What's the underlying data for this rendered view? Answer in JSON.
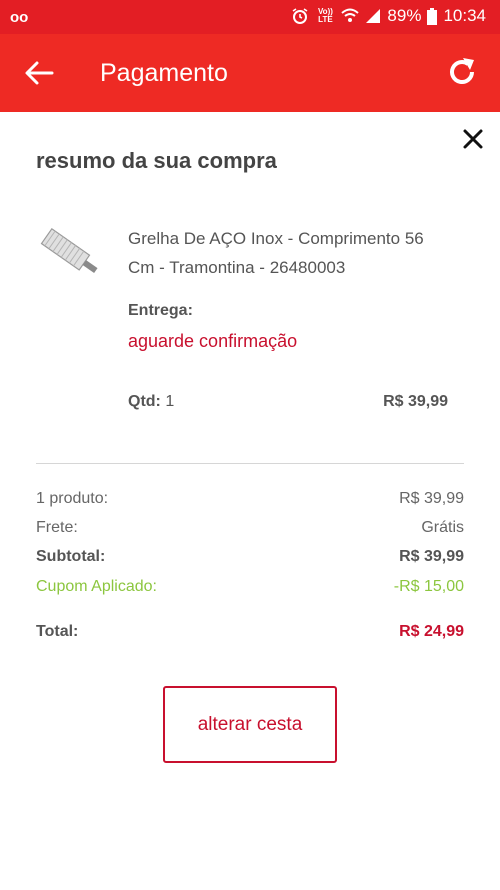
{
  "status_bar": {
    "left_icon": "voicemail-icon",
    "lte": "Vo)) LTE",
    "battery": "89%",
    "time": "10:34"
  },
  "app_bar": {
    "title": "Pagamento"
  },
  "summary": {
    "heading": "resumo da sua compra",
    "product": {
      "name": "Grelha De AÇO Inox - Comprimento 56 Cm - Tramontina - 26480003",
      "entrega_label": "Entrega:",
      "entrega_status": "aguarde confirmação",
      "qtd_label": "Qtd:",
      "qtd_value": "1",
      "price": "R$ 39,99"
    },
    "totals": [
      {
        "label": "1 produto:",
        "value": "R$ 39,99"
      },
      {
        "label": "Frete:",
        "value": "Grátis"
      },
      {
        "label": "Subtotal:",
        "value": "R$ 39,99"
      },
      {
        "label": "Cupom Aplicado:",
        "value": "-R$ 15,00"
      },
      {
        "label": "Total:",
        "value": "R$ 24,99"
      }
    ],
    "button_label": "alterar cesta"
  },
  "colors": {
    "primary": "#ee2a24",
    "accent_red": "#c8102e",
    "coupon_green": "#8cc63f"
  }
}
